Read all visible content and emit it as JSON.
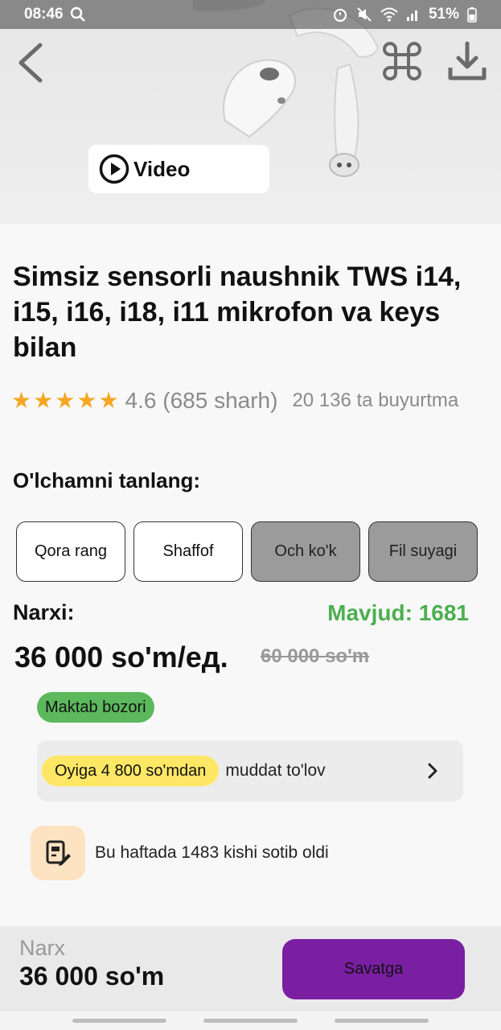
{
  "status": {
    "time": "08:46",
    "battery": "51%"
  },
  "hero": {
    "video_label": "Video"
  },
  "product": {
    "title": "Simsiz sensorli naushnik TWS i14, i15, i16, i18, i11 mikrofon va keys bilan",
    "rating_text": "4.6 (685 sharh)",
    "rating_value": 4.6,
    "stars_filled": 5,
    "orders_text": "20 136 ta buyurtma"
  },
  "options": {
    "label": "O'lchamni tanlang:",
    "items": [
      {
        "label": "Qora rang",
        "available": true
      },
      {
        "label": "Shaffof",
        "available": true
      },
      {
        "label": "Och ko'k",
        "available": false
      },
      {
        "label": "Fil suyagi",
        "available": false
      }
    ]
  },
  "price": {
    "label": "Narxi:",
    "stock_text": "Mavjud: 1681",
    "current": "36 000 so'm/ед.",
    "old": "60 000 so'm"
  },
  "badge": {
    "label": "Maktab bozori"
  },
  "installment": {
    "pill": "Oyiga 4 800 so'mdan",
    "text": "muddat to'lov"
  },
  "buyers": {
    "text": "Bu haftada 1483 kishi sotib oldi"
  },
  "bottom": {
    "price_label": "Narx",
    "price_value": "36 000 so'm",
    "cart_label": "Savatga"
  },
  "colors": {
    "star": "#f5a623",
    "stock": "#4caf50",
    "badge": "#5cb85c",
    "pill": "#ffe766",
    "cart": "#7a1fa2"
  }
}
